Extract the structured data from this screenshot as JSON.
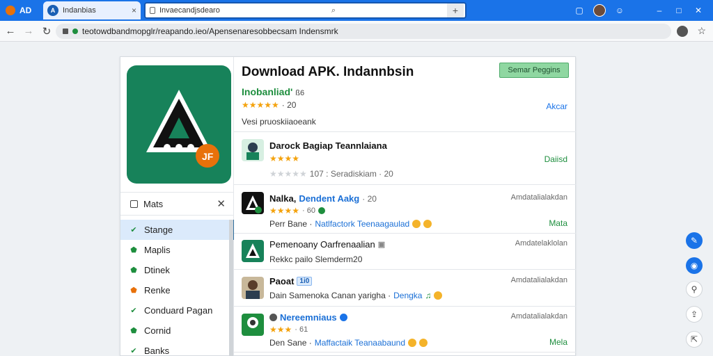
{
  "browser": {
    "tab1_label": "AD",
    "tab2_label": "Indanbias",
    "tab2_close": "×",
    "top_search_text": "Invaecandjsdearo",
    "url": "teotowdbandmopglr/reapando.ieo/Apensenaresobbecsam Indensmrk"
  },
  "hero": {
    "title": "Download APK. Indannbsin",
    "button_label": "Semar Peggins",
    "developer": "Inobanliad'",
    "developer_sub": "ß6",
    "rating_text": "· 20",
    "link": "Akcar",
    "description": "Vesi pruoskiiaoeank"
  },
  "sidebar": {
    "header": "Mats",
    "items": [
      {
        "label": "Stange",
        "icon": "check-icon",
        "color": "#1e8e3e"
      },
      {
        "label": "Maplis",
        "icon": "shield-icon",
        "color": "#1e8e3e"
      },
      {
        "label": "Dtinek",
        "icon": "shield-icon",
        "color": "#1e8e3e"
      },
      {
        "label": "Renke",
        "icon": "shield-icon",
        "color": "#e8710a"
      },
      {
        "label": "Conduard Pagan",
        "icon": "check-icon",
        "color": "#1e8e3e"
      },
      {
        "label": "Cornid",
        "icon": "shield-icon",
        "color": "#1e8e3e"
      },
      {
        "label": "Banks",
        "icon": "check-icon",
        "color": "#1e8e3e"
      }
    ]
  },
  "list": [
    {
      "title": "Darock Bagiap Teannlaiana",
      "rating_text": "107 : Seradiskiam · 20",
      "action": "Daiisd",
      "meta": ""
    },
    {
      "title": "Nalka,",
      "title_blue": "Dendent Aakg",
      "title_extra": "· 20",
      "rating_text": "· 60",
      "sub": "Perr Bane · ",
      "sub_blue": "Natlfactork Teenaagaulad",
      "meta": "Amdatalialakdan",
      "action": "Mata"
    },
    {
      "title": "Pemenoany Oarfrenaalian",
      "sub": "Rekkc pailo Slemderm20",
      "meta": "Amdatelaklolan",
      "action": ""
    },
    {
      "title": "Paoat",
      "badge": "1i0",
      "sub": "Dain Samenoka Canan yarigha · ",
      "sub_blue": "Dengka",
      "meta": "Amdatalialakdan",
      "action": ""
    },
    {
      "title": "·",
      "title_blue": "Nereemniaus",
      "rating_text": "· 61",
      "sub": "Den Sane · ",
      "sub_blue": "Maffactaik Teanaabaund",
      "meta": "Amdatalialakdan",
      "action": "Mela"
    }
  ],
  "colors": {
    "accent": "#1a73e8",
    "brand_green": "#17825a",
    "action_green": "#1e8e3e"
  }
}
